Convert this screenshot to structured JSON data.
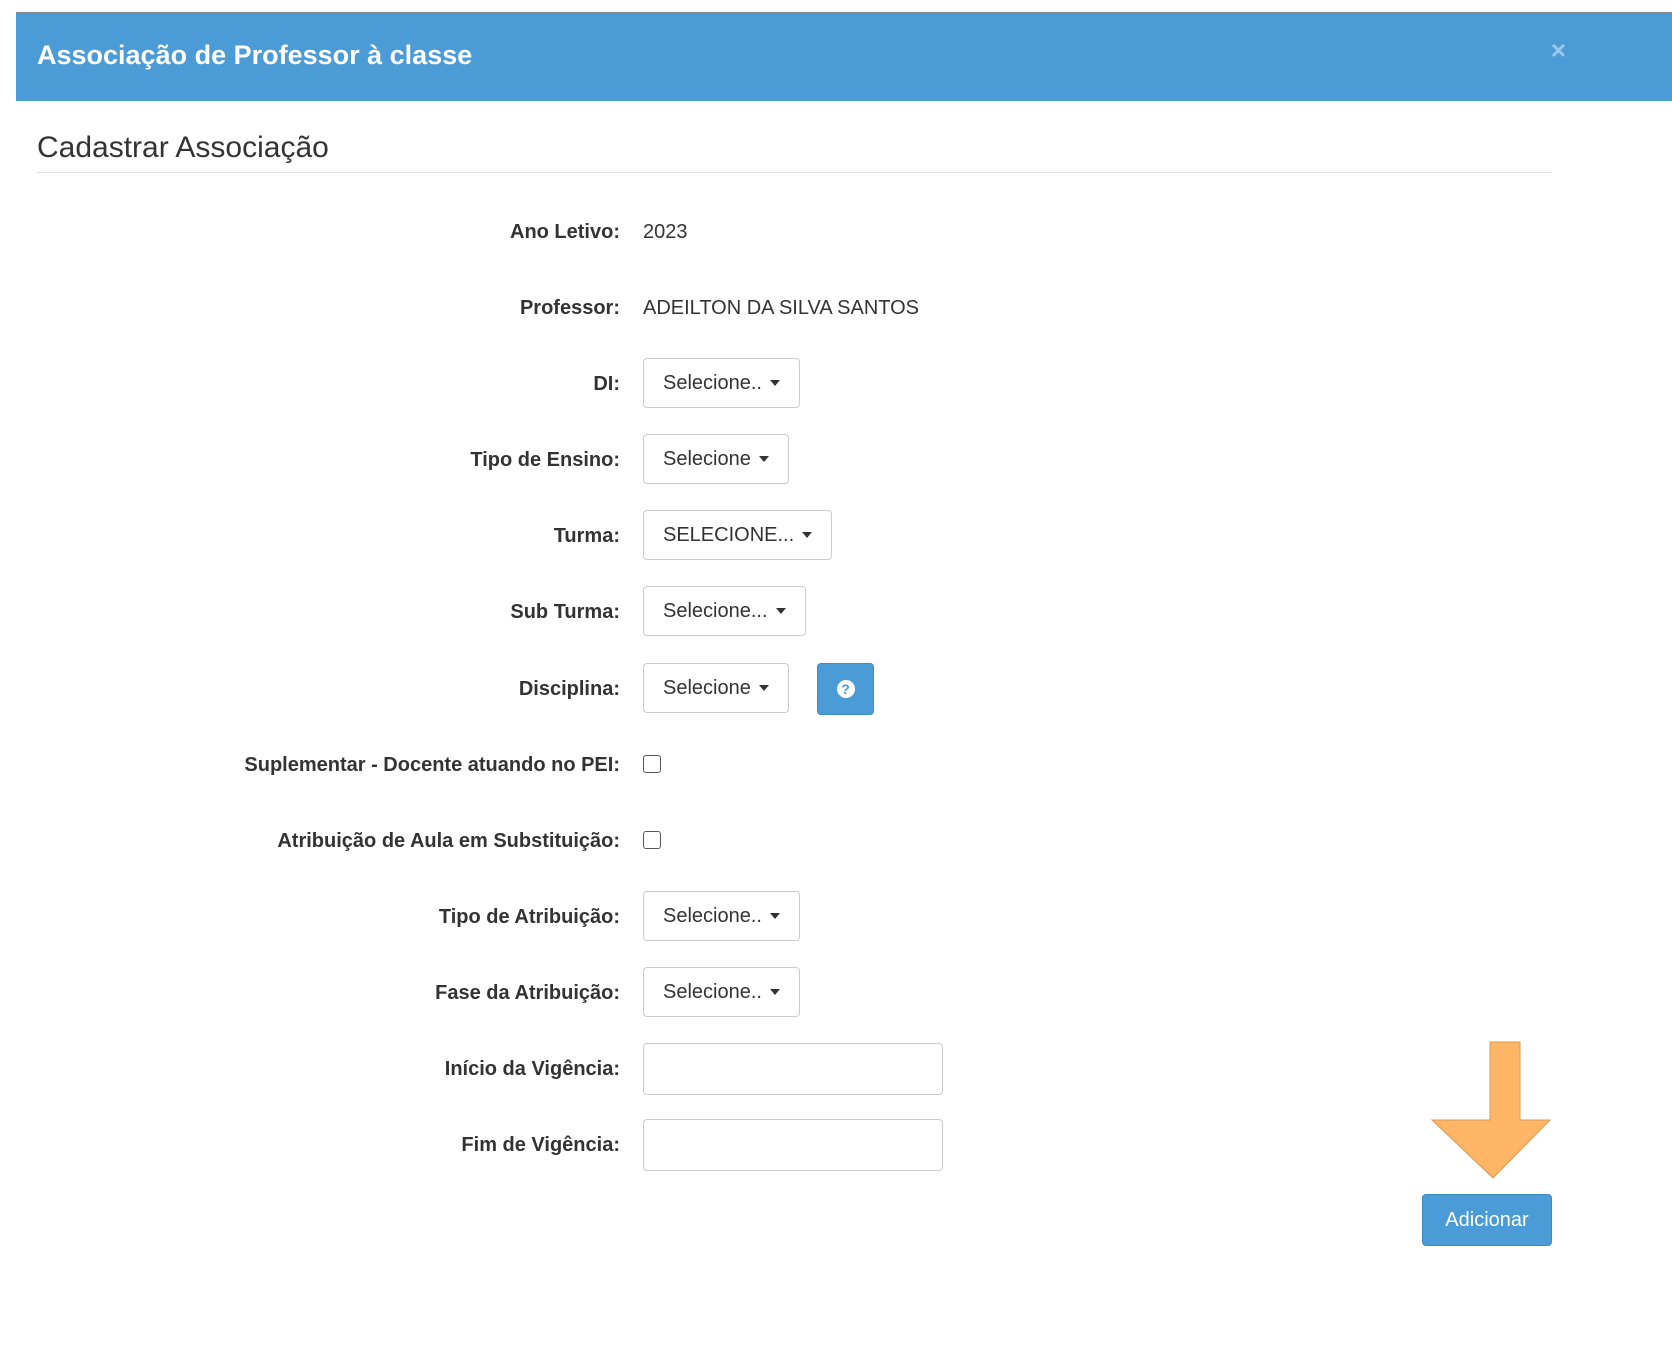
{
  "header": {
    "title": "Associação de Professor à classe",
    "close_label": "×",
    "accent_color": "#4a9bd6"
  },
  "section": {
    "title": "Cadastrar Associação"
  },
  "form": {
    "ano_letivo": {
      "label": "Ano Letivo:",
      "value": "2023"
    },
    "professor": {
      "label": "Professor:",
      "value": "ADEILTON DA SILVA SANTOS"
    },
    "di": {
      "label": "DI:",
      "selected": "Selecione.."
    },
    "tipo_ensino": {
      "label": "Tipo de Ensino:",
      "selected": "Selecione"
    },
    "turma": {
      "label": "Turma:",
      "selected": "SELECIONE..."
    },
    "sub_turma": {
      "label": "Sub Turma:",
      "selected": "Selecione..."
    },
    "disciplina": {
      "label": "Disciplina:",
      "selected": "Selecione",
      "help_icon": "question-circle-icon"
    },
    "suplementar": {
      "label": "Suplementar - Docente atuando no PEI:",
      "checked": false
    },
    "substituicao": {
      "label": "Atribuição de Aula em Substituição:",
      "checked": false
    },
    "tipo_atribuicao": {
      "label": "Tipo de Atribuição:",
      "selected": "Selecione.."
    },
    "fase_atribuicao": {
      "label": "Fase da Atribuição:",
      "selected": "Selecione.."
    },
    "inicio_vigencia": {
      "label": "Início da Vigência:",
      "value": ""
    },
    "fim_vigencia": {
      "label": "Fim de Vigência:",
      "value": ""
    }
  },
  "actions": {
    "add_label": "Adicionar",
    "arrow_color": "#ffb566"
  }
}
